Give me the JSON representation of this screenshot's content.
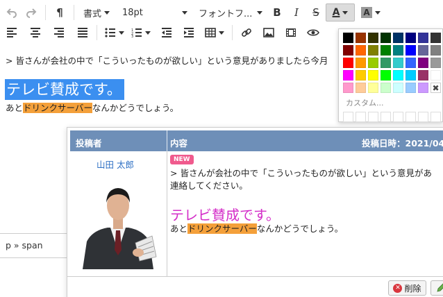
{
  "toolbar1": {
    "format_label": "書式",
    "size_label": "18pt",
    "font_label": "フォントフ..."
  },
  "editor": {
    "line1": "> 皆さんが会社の中で「こういったものが欲しい」という意見がありましたら今月",
    "big_text": "テレビ賛成です。",
    "line3_pre": "あと",
    "line3_hl": "ドリンクサーバー",
    "line3_post": "なんかどうでしょう。"
  },
  "path": "p » span",
  "color_picker": {
    "custom_label": "カスタム...",
    "remove_symbol": "✖",
    "colors": [
      "#000000",
      "#993300",
      "#333300",
      "#003300",
      "#003366",
      "#000080",
      "#333399",
      "#333333",
      "#800000",
      "#ff6600",
      "#808000",
      "#008000",
      "#008080",
      "#0000ff",
      "#666699",
      "#808080",
      "#ff0000",
      "#ff9900",
      "#99cc00",
      "#339966",
      "#33cccc",
      "#3366ff",
      "#800080",
      "#999999",
      "#ff00ff",
      "#ffcc00",
      "#ffff00",
      "#00ff00",
      "#00ffff",
      "#00ccff",
      "#993366",
      "#ffffff",
      "#ff99cc",
      "#ffcc99",
      "#ffff99",
      "#ccffcc",
      "#ccffff",
      "#99ccff",
      "#cc99ff"
    ]
  },
  "preview": {
    "col_author": "投稿者",
    "col_content": "内容",
    "col_date": "投稿日時：2021/04",
    "author": "山田 太郎",
    "new_badge": "NEW",
    "line1": "> 皆さんが会社の中で「こういったものが欲しい」という意見があ",
    "line2": "連絡してください。",
    "big_text": "テレビ賛成です。",
    "line3_pre": "あと",
    "line3_hl": "ドリンクサーバー",
    "line3_post": "なんかどうでしょう。",
    "delete_label": "削除"
  }
}
